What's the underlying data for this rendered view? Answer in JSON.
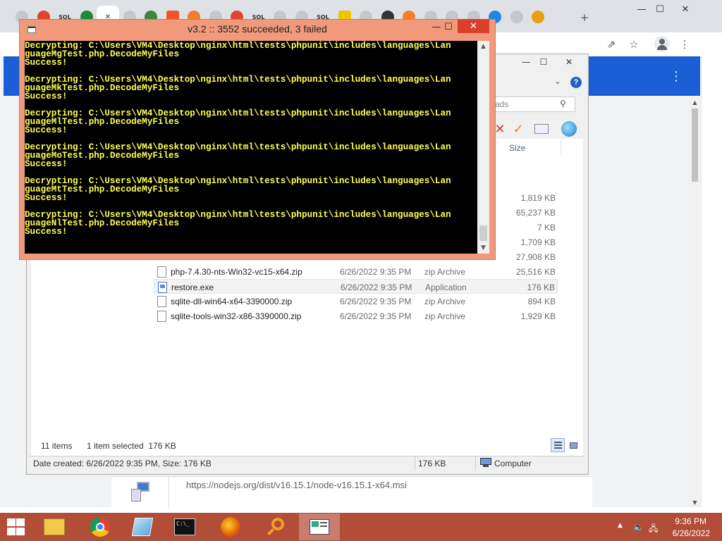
{
  "browser": {
    "tab_icons": [
      "chrome-tab-icon",
      "red-tab-icon",
      "sql-tab-icon",
      "green-shield-tab-icon",
      "active-tab-close-icon",
      "chrome-tab-icon",
      "nodejs-tab-icon",
      "microsoft-tab-icon",
      "orange-tab-icon",
      "chrome-tab-icon",
      "red-tab-icon",
      "sql-tab-icon",
      "github-tab-icon",
      "diamond-tab-icon",
      "sql-tab-icon",
      "yellow-tab-icon",
      "chrome-tab-icon",
      "paw-tab-icon",
      "orange-tab-icon",
      "chrome-tab-icon",
      "chrome-tab-icon",
      "gear-tab-icon",
      "cloud-tab-icon",
      "globe-tab-icon",
      "search-tab-icon"
    ],
    "sql_label": "SQL",
    "new_tab_label": "+",
    "window_controls": {
      "minimize": "—",
      "maximize": "☐",
      "close": "✕"
    },
    "toolbar_icons": {
      "share": "⇗",
      "bookmark": "☆",
      "menu": "⋮"
    },
    "page_menu": "⋮",
    "download": {
      "url": "https://nodejs.org/dist/v16.15.1/node-v16.15.1-x64.msi"
    }
  },
  "console": {
    "title": "v3.2 :: 3552 succeeded, 3 failed",
    "controls": {
      "minimize": "—",
      "maximize": "☐",
      "close": "✕"
    },
    "lines": [
      "Decrypting: C:\\Users\\VM4\\Desktop\\nginx\\html\\tests\\phpunit\\includes\\languages\\Lan",
      "guageMgTest.php.DecodeMyFiles",
      "Success!",
      "",
      "Decrypting: C:\\Users\\VM4\\Desktop\\nginx\\html\\tests\\phpunit\\includes\\languages\\Lan",
      "guageMkTest.php.DecodeMyFiles",
      "Success!",
      "",
      "Decrypting: C:\\Users\\VM4\\Desktop\\nginx\\html\\tests\\phpunit\\includes\\languages\\Lan",
      "guageMlTest.php.DecodeMyFiles",
      "Success!",
      "",
      "Decrypting: C:\\Users\\VM4\\Desktop\\nginx\\html\\tests\\phpunit\\includes\\languages\\Lan",
      "guageMoTest.php.DecodeMyFiles",
      "Success!",
      "",
      "Decrypting: C:\\Users\\VM4\\Desktop\\nginx\\html\\tests\\phpunit\\includes\\languages\\Lan",
      "guageMtTest.php.DecodeMyFiles",
      "Success!",
      "",
      "Decrypting: C:\\Users\\VM4\\Desktop\\nginx\\html\\tests\\phpunit\\includes\\languages\\Lan",
      "guageNlTest.php.DecodeMyFiles",
      "Success!"
    ]
  },
  "explorer": {
    "controls": {
      "minimize": "—",
      "maximize": "☐",
      "close": "✕"
    },
    "help_label": "?",
    "search_placeholder": "ads",
    "size_header": "Size",
    "partial_sizes": [
      "1,819 KB",
      "65,237 KB",
      "7 KB",
      "1,709 KB",
      "27,908 KB"
    ],
    "files": [
      {
        "name": "php-7.4.30-nts-Win32-vc15-x64.zip",
        "date": "6/26/2022 9:35 PM",
        "type": "zip Archive",
        "size": "25,516 KB",
        "icon": "zip-file-icon",
        "state": "normal"
      },
      {
        "name": "restore.exe",
        "date": "6/26/2022 9:35 PM",
        "type": "Application",
        "size": "176 KB",
        "icon": "application-file-icon",
        "state": "selected"
      },
      {
        "name": "sqlite-dll-win64-x64-3390000.zip",
        "date": "6/26/2022 9:35 PM",
        "type": "zip Archive",
        "size": "894 KB",
        "icon": "zip-file-icon",
        "state": "normal"
      },
      {
        "name": "sqlite-tools-win32-x86-3390000.zip",
        "date": "6/26/2022 9:35 PM",
        "type": "zip Archive",
        "size": "1,929 KB",
        "icon": "zip-file-icon",
        "state": "normal"
      }
    ],
    "status": {
      "item_count": "11 items",
      "selection": "1 item selected  176 KB",
      "details": "Date created: 6/26/2022 9:35 PM, Size: 176 KB",
      "size": "176 KB",
      "location": "Computer"
    }
  },
  "taskbar": {
    "items": [
      "file-explorer-icon",
      "chrome-icon",
      "notepad-icon",
      "command-prompt-icon",
      "firefox-icon",
      "search-tool-icon",
      "restore-app-icon"
    ],
    "cmd_label": "C:\\_",
    "clock": {
      "time": "9:36 PM",
      "date": "6/26/2022"
    },
    "tray": {
      "up_arrow": "▲",
      "volume": "🔈",
      "network": "🖧"
    }
  },
  "colors": {
    "console_frame": "#f19a7b",
    "console_text": "#ffff55",
    "taskbar": "#b24d38",
    "close_button": "#d9402b",
    "page_band": "#1a5fd6"
  }
}
